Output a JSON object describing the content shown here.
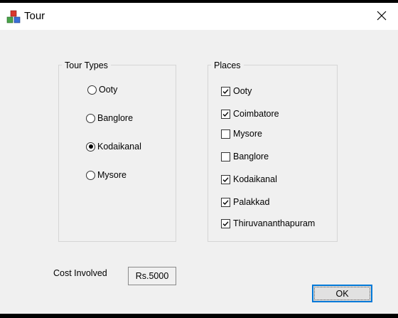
{
  "window": {
    "title": "Tour",
    "close_glyph": "✕",
    "icon": "app-cubes-icon"
  },
  "tour_types": {
    "legend": "Tour Types",
    "options": [
      {
        "label": "Ooty",
        "selected": false
      },
      {
        "label": "Banglore",
        "selected": false
      },
      {
        "label": "Kodaikanal",
        "selected": true
      },
      {
        "label": "Mysore",
        "selected": false
      }
    ]
  },
  "places": {
    "legend": "Places",
    "items": [
      {
        "label": "Ooty",
        "checked": true
      },
      {
        "label": "Coimbatore",
        "checked": true
      },
      {
        "label": "Mysore",
        "checked": false
      },
      {
        "label": "Banglore",
        "checked": false
      },
      {
        "label": "Kodaikanal",
        "checked": true
      },
      {
        "label": "Palakkad",
        "checked": true
      },
      {
        "label": "Thiruvananthapuram",
        "checked": true
      }
    ]
  },
  "cost": {
    "label": "Cost Involved",
    "value": "Rs.5000"
  },
  "buttons": {
    "ok_label": "OK"
  },
  "colors": {
    "accent": "#0078d7",
    "background": "#f0f0f0"
  }
}
